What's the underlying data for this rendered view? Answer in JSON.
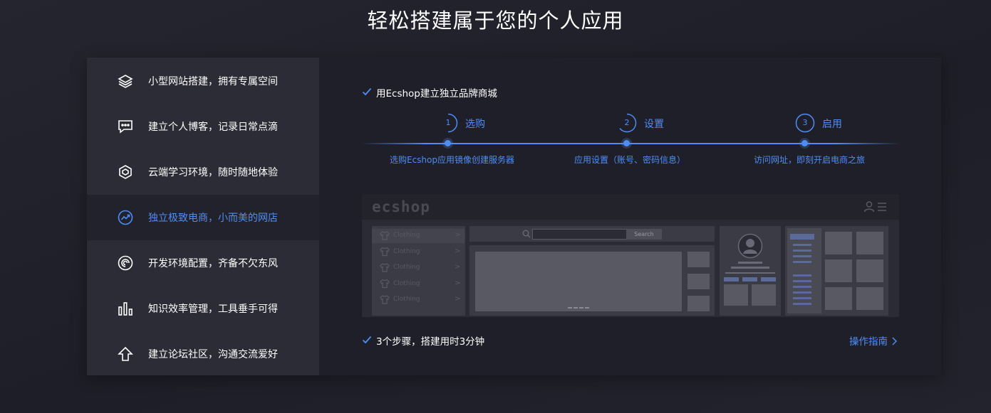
{
  "page": {
    "title": "轻松搭建属于您的个人应用"
  },
  "sidebar": {
    "items": [
      {
        "label": "小型网站搭建，拥有专属空间",
        "icon": "layers-icon"
      },
      {
        "label": "建立个人博客，记录日常点滴",
        "icon": "chat-bubble-icon"
      },
      {
        "label": "云端学习环境，随时随地体验",
        "icon": "hexagon-icon"
      },
      {
        "label": "独立极致电商，小而美的网店",
        "icon": "trend-circle-icon",
        "active": true
      },
      {
        "label": "开发环境配置，齐备不欠东风",
        "icon": "spiral-icon"
      },
      {
        "label": "知识效率管理，工具垂手可得",
        "icon": "bar-chart-icon"
      },
      {
        "label": "建立论坛社区，沟通交流爱好",
        "icon": "arrow-up-icon"
      }
    ]
  },
  "main": {
    "headline": "用Ecshop建立独立品牌商城",
    "steps": [
      {
        "num": "1",
        "label": "选购",
        "desc": "选购Ecshop应用镜像创建服务器"
      },
      {
        "num": "2",
        "label": "设置",
        "desc": "应用设置（账号、密码信息）"
      },
      {
        "num": "3",
        "label": "启用",
        "desc": "访问网址，即刻开启电商之旅"
      }
    ],
    "footer_note": "3个步骤，搭建用时3分钟",
    "guide_link": "操作指南",
    "mockup": {
      "logo": "ecshop",
      "search_button": "Search",
      "categories": [
        "Clothing",
        "Clothing",
        "Clothing",
        "Clothing",
        "Clothing"
      ]
    }
  },
  "colors": {
    "accent": "#4f8df5",
    "sidebar_bg": "#2c2c36",
    "panel_bg": "#1f1f29"
  }
}
